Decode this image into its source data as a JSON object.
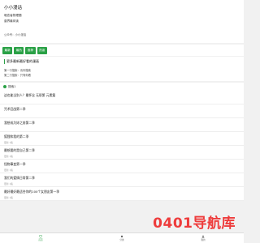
{
  "profile": {
    "title": "小小漫话",
    "line1": "暗恋者物理题",
    "line2": "普界最闷读",
    "label": "公众号：小小漫话"
  },
  "tabs": [
    "最新",
    "最热",
    "推荐",
    "热读"
  ],
  "notice": {
    "title": "更多最新最好看的漫画",
    "line1": "第一行搜索：请你搜索",
    "line2": "第二行搜索：只有你看"
  },
  "section": {
    "title": "搜索1"
  },
  "items": [
    {
      "title": "这也能当别人？最怀念 无职第 元素篇",
      "meta": ""
    },
    {
      "title": "咒术回战第二季",
      "meta": ""
    },
    {
      "title": "我想成为妳之前第二季",
      "meta": ""
    },
    {
      "title": "狐狸和我的第二季",
      "meta": "更新 1集"
    },
    {
      "title": "最想要的是自己第二季",
      "meta": "更新 1集"
    },
    {
      "title": "怪物事变第一季",
      "meta": "更新 1集"
    },
    {
      "title": "我们的爱情日常第二季",
      "meta": "更新 1集"
    },
    {
      "title": "最好最好最适合你的100个女朋友第一季",
      "meta": "更新 1集"
    }
  ],
  "nav": [
    {
      "label": "首页",
      "icon": "heart-icon"
    },
    {
      "label": "分类",
      "icon": "dot-icon"
    },
    {
      "label": "我的",
      "icon": "user-icon"
    }
  ],
  "watermark": "0401导航库",
  "colors": {
    "accent": "#2aa146",
    "watermark": "#e33333"
  }
}
